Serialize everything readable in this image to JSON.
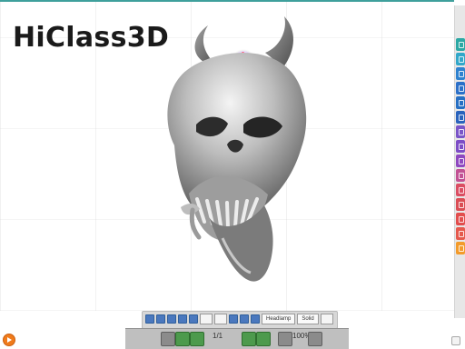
{
  "branding": {
    "title": "HiClass3D"
  },
  "toolbar": {
    "shading_label": "Headlamp",
    "mode_label": "Solid",
    "zoom_label": "100%",
    "page_label": "1/1"
  },
  "colors": {
    "accent": "#3fa09c",
    "right_toolbar": [
      "#2ca8a4",
      "#32a7c9",
      "#2f82cf",
      "#2c70c8",
      "#276fc3",
      "#2a63bc",
      "#7a55c8",
      "#7d4dc6",
      "#8e48c0",
      "#c25294",
      "#db4e63",
      "#da4d55",
      "#e24d4d",
      "#e5594d",
      "#f39b2b"
    ]
  },
  "icons": {
    "orientation": "view-cube-icon",
    "play": "play-icon",
    "settings": "gear-icon"
  }
}
